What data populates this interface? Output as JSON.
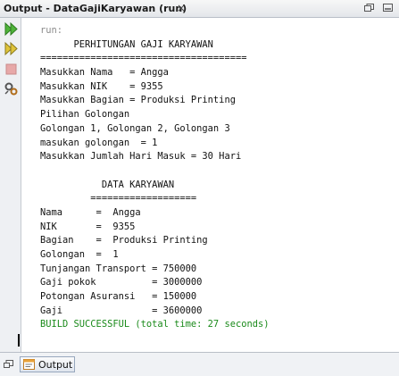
{
  "window": {
    "title": "Output - DataGajiKaryawan (run)",
    "close_glyph": "×"
  },
  "toolbar": {
    "buttons": [
      {
        "name": "rerun-icon"
      },
      {
        "name": "rerun-with-options-icon"
      },
      {
        "name": "stop-icon"
      },
      {
        "name": "settings-icon"
      }
    ]
  },
  "console": {
    "lines": [
      "run:",
      "      PERHITUNGAN GAJI KARYAWAN",
      "=====================================",
      "Masukkan Nama   = Angga",
      "Masukkan NIK    = 9355",
      "Masukkan Bagian = Produksi Printing",
      "Pilihan Golongan",
      "Golongan 1, Golongan 2, Golongan 3",
      "masukan golongan  = 1",
      "Masukkan Jumlah Hari Masuk = 30 Hari",
      "",
      "           DATA KARYAWAN",
      "         ===================",
      "Nama      =  Angga",
      "NIK       =  9355",
      "Bagian    =  Produksi Printing",
      "Golongan  =  1",
      "Tunjangan Transport = 750000",
      "Gaji pokok          = 3000000",
      "Potongan Asuransi   = 150000",
      "Gaji                = 3600000",
      "BUILD SUCCESSFUL (total time: 27 seconds)"
    ]
  },
  "bottom": {
    "tab_label": "Output"
  },
  "colors": {
    "build_success": "#1a8a1a",
    "run_label": "#8b8b8b"
  }
}
